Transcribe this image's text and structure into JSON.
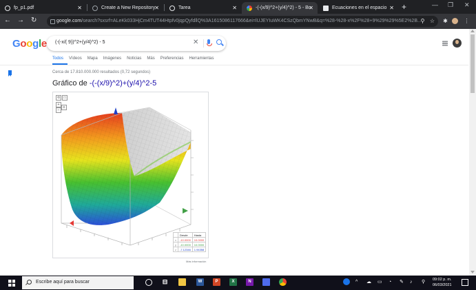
{
  "tabs": [
    {
      "title": "fp_p1.pdf",
      "active": false
    },
    {
      "title": "Create a New Repository",
      "active": false
    },
    {
      "title": "Tarea",
      "active": false
    },
    {
      "title": "-(-(x/9)^2+(y/4)^2) - 5 - Bu",
      "active": true
    },
    {
      "title": "Ecuaciones en el espacio",
      "active": false
    }
  ],
  "address": {
    "host": "google.com",
    "path": "/search?sxsrf=ALeKk033HjCm4TUT44Htpfv0jqpQyfdllQ%3A1615086117666&ei=lUJEYIuWK4CSzQbmYNwB&q=%28-%28-x%2F%28+9%29%29%5E2%2B..."
  },
  "google": {
    "logo": "Google",
    "query": "(-(-x/( 9))^2+(y/4)^2) - 5",
    "tabs": [
      "Todos",
      "Vídeos",
      "Mapa",
      "Imágenes",
      "Noticias",
      "Más",
      "Preferencias",
      "Herramientas"
    ],
    "results": "Cerca de 17.810.000.000 resultados (0,72 segundos)",
    "heading_prefix": "Gráfico de",
    "heading_function": "-(-(x/9)^2)+(y/4)^2-5",
    "credit": "Más información"
  },
  "graph": {
    "legend": [
      {
        "axis": "x",
        "from": "-10.0000",
        "to": "10.0000"
      },
      {
        "axis": "y",
        "from": "-10.0000",
        "to": "10.0000"
      },
      {
        "axis": "z",
        "from": "-7.12346",
        "to": "1.94358"
      }
    ],
    "legend_headers": [
      "Desde",
      "Hasta"
    ],
    "axis_colors": {
      "x": "#e53935",
      "y": "#43a047",
      "z": "#1e40c8"
    }
  },
  "taskbar": {
    "search_placeholder": "Escribe aquí para buscar",
    "time": "09:02 p. m.",
    "date": "06/03/2021"
  }
}
